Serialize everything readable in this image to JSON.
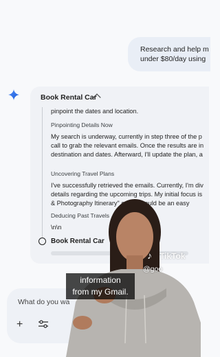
{
  "user_message": {
    "line1": "Research and help m",
    "line2": "under $80/day using"
  },
  "panel": {
    "title": "Book Rental Car",
    "steps": [
      {
        "type": "text",
        "text": "pinpoint the dates and location."
      },
      {
        "type": "heading",
        "text": "Pinpointing Details Now"
      },
      {
        "type": "text",
        "text": "My search is underway, currently in step three of the p"
      },
      {
        "type": "text",
        "text": "call to grab the relevant emails. Once the results are in"
      },
      {
        "type": "text",
        "text": "destination and dates. Afterward, I'll update the plan, a"
      },
      {
        "type": "heading",
        "text": "Uncovering Travel Plans"
      },
      {
        "type": "text",
        "text": "I've successfully retrieved the emails. Currently, I'm div"
      },
      {
        "type": "text",
        "text": "details regarding the upcoming trips. My initial focus is"
      },
      {
        "type": "text",
        "text": "& Photography Itinerary\" e... ls should be an easy"
      },
      {
        "type": "heading",
        "text": "Deducing Past Travels"
      },
      {
        "type": "text",
        "text": "\\n\\n"
      }
    ],
    "current_step": "Book Rental Car"
  },
  "input": {
    "placeholder": "What do you wa"
  },
  "overlay": {
    "caption_line1": "information",
    "caption_line2": "from my Gmail.",
    "tiktok_label": "TikTok",
    "tiktok_handle": "@goo"
  },
  "colors": {
    "background": "#f8f9fb",
    "user_bubble": "#e9eef6",
    "panel": "#f0f2f6",
    "gemini_blue": "#4285f4"
  }
}
